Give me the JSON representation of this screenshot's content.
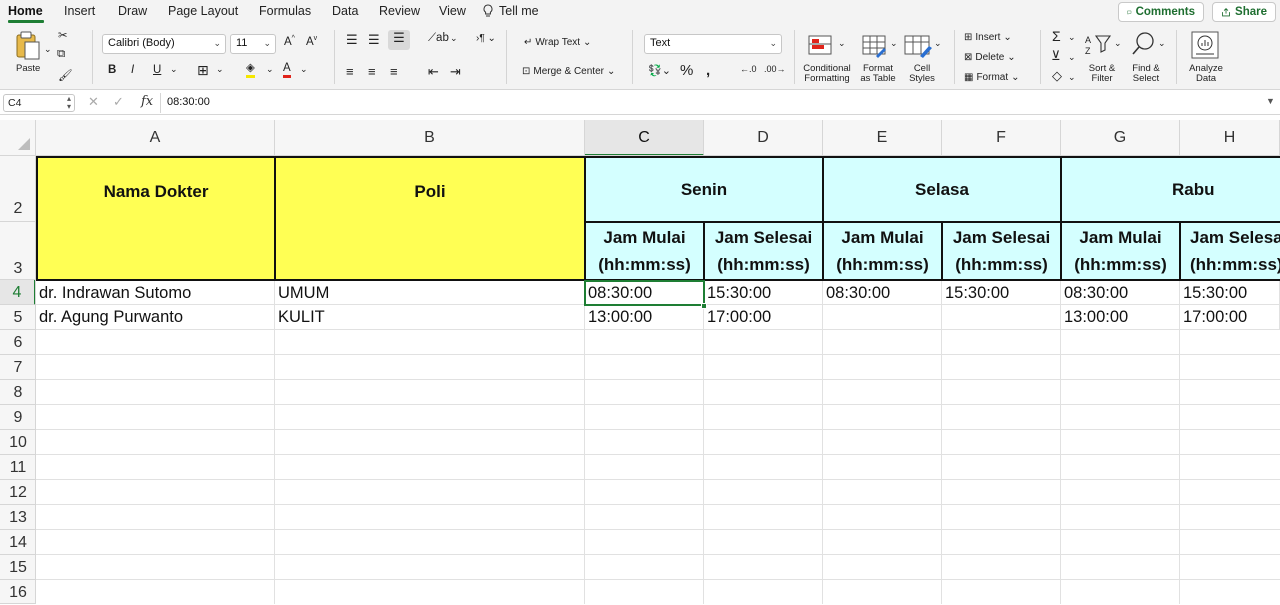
{
  "tabs": [
    "Home",
    "Insert",
    "Draw",
    "Page Layout",
    "Formulas",
    "Data",
    "Review",
    "View"
  ],
  "tell_me": "Tell me",
  "comments_label": "Comments",
  "share_label": "Share",
  "ribbon": {
    "paste": "Paste",
    "font_name": "Calibri (Body)",
    "font_size": "11",
    "wrap_text": "Wrap Text",
    "merge_center": "Merge & Center",
    "number_format": "Text",
    "conditional_formatting": [
      "Conditional",
      "Formatting"
    ],
    "format_as_table": [
      "Format",
      "as Table"
    ],
    "cell_styles": [
      "Cell",
      "Styles"
    ],
    "insert": "Insert",
    "delete": "Delete",
    "format": "Format",
    "sort_filter": [
      "Sort &",
      "Filter"
    ],
    "find_select": [
      "Find &",
      "Select"
    ],
    "analyze_data": [
      "Analyze",
      "Data"
    ]
  },
  "formula_bar": {
    "name_box": "C4",
    "fx": "fx",
    "value": "08:30:00"
  },
  "columns": [
    "A",
    "B",
    "C",
    "D",
    "E",
    "F",
    "G",
    "H"
  ],
  "rows": [
    "2",
    "3",
    "4",
    "5",
    "6",
    "7",
    "8",
    "9",
    "10",
    "11",
    "12",
    "13",
    "14",
    "15",
    "16"
  ],
  "headers": {
    "nama_dokter": "Nama Dokter",
    "poli": "Poli",
    "days": [
      "Senin",
      "Selasa",
      "Rabu"
    ],
    "jam_mulai": [
      "Jam Mulai",
      "(hh:mm:ss)"
    ],
    "jam_selesai": [
      "Jam Selesai",
      "(hh:mm:ss)"
    ]
  },
  "data_rows": [
    [
      "dr. Indrawan Sutomo",
      "UMUM",
      "08:30:00",
      "15:30:00",
      "08:30:00",
      "15:30:00",
      "08:30:00",
      "15:30:00"
    ],
    [
      "dr. Agung Purwanto",
      "KULIT",
      "13:00:00",
      "17:00:00",
      "",
      "",
      "13:00:00",
      "17:00:00"
    ]
  ],
  "colors": {
    "accent": "#1e7e34",
    "header_yellow": "#ffff54",
    "header_cyan": "#d4ffff"
  }
}
